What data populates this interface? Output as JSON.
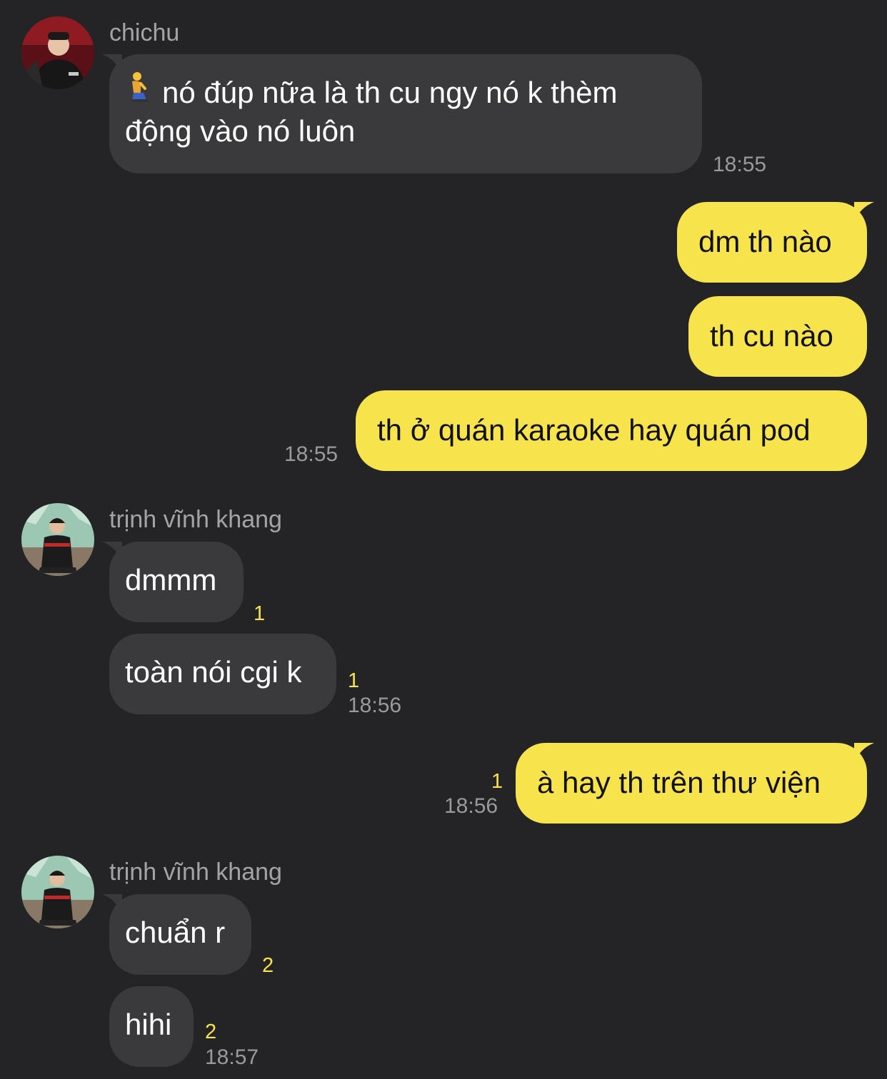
{
  "colors": {
    "background": "#242426",
    "incoming_bubble": "#3a3a3c",
    "outgoing_bubble": "#f7e34b",
    "unread_count": "#f7e34b",
    "timestamp": "#9a9a9c"
  },
  "messages": {
    "g1": {
      "sender": "chichu",
      "m1": {
        "emoji": "kneeling-person",
        "text": "nó đúp nữa là th cu ngy nó k thèm",
        "text2": "động vào nó luôn"
      },
      "time": "18:55"
    },
    "g2": {
      "m1": "dm th nào",
      "m2": "th cu nào",
      "m3": "th ở quán karaoke hay quán pod",
      "time": "18:55"
    },
    "g3": {
      "sender": "trịnh vĩnh khang",
      "m1": "dmmm",
      "m1_unread": "1",
      "m2": "toàn nói cgi k",
      "m2_unread": "1",
      "time": "18:56"
    },
    "g4": {
      "m1": "à hay th trên thư viện",
      "unread": "1",
      "time": "18:56"
    },
    "g5": {
      "sender": "trịnh vĩnh khang",
      "m1": "chuẩn r",
      "m1_unread": "2",
      "m2": "hihi",
      "m2_unread": "2",
      "time": "18:57"
    }
  }
}
